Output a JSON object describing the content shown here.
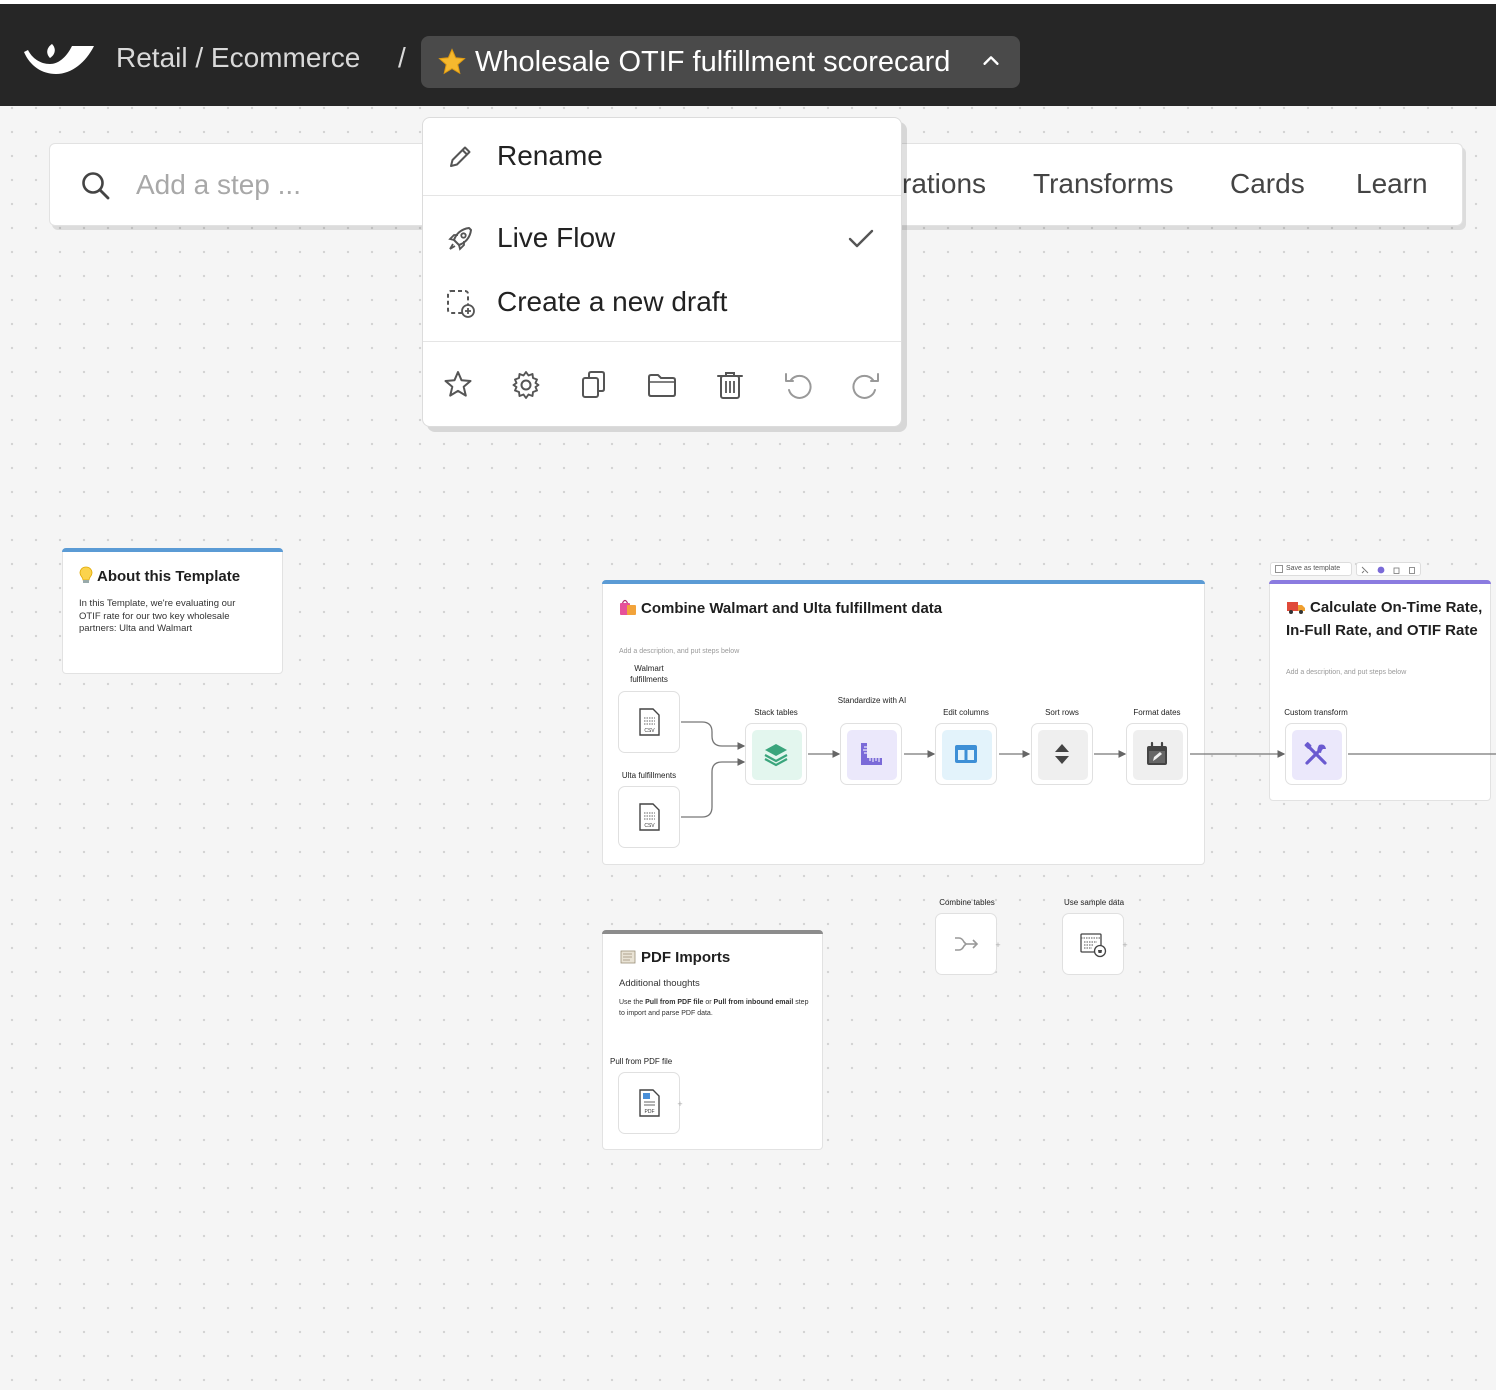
{
  "header": {
    "breadcrumb": "Retail / Ecommerce",
    "separator": "/",
    "flow_title": "Wholesale OTIF fulfillment scorecard"
  },
  "toolbar": {
    "search_placeholder": "Add a step ...",
    "tabs": [
      "rations",
      "Transforms",
      "Cards",
      "Learn"
    ]
  },
  "menu": {
    "rename": "Rename",
    "live_flow": "Live Flow",
    "live_flow_checked": true,
    "new_draft": "Create a new draft",
    "actions": [
      "star-icon",
      "gear-icon",
      "copy-icon",
      "folder-icon",
      "trash-icon",
      "undo-icon",
      "redo-icon"
    ]
  },
  "cards": {
    "about": {
      "title": "About this Template",
      "body": "In this Template, we're evaluating our OTIF rate for our two key wholesale partners: Ulta and Walmart"
    },
    "combine": {
      "title": "Combine Walmart and Ulta fulfillment data",
      "hint": "Add a description, and put steps below"
    },
    "calculate": {
      "title": "Calculate On-Time Rate, In-Full Rate, and OTIF Rate",
      "hint": "Add a description, and put steps below",
      "save_template": "Save as template"
    },
    "pdf": {
      "title": "PDF Imports",
      "subtitle": "Additional thoughts",
      "body_pre": "Use the ",
      "body_b1": "Pull from PDF file",
      "body_mid": " or ",
      "body_b2": "Pull from inbound email",
      "body_post": " step to import and parse PDF data."
    }
  },
  "nodes": {
    "walmart": "Walmart fulfillments",
    "ulta": "Ulta fulfillments",
    "stack": "Stack tables",
    "standardize": "Standardize with AI",
    "edit_columns": "Edit columns",
    "sort_rows": "Sort rows",
    "format_dates": "Format dates",
    "custom_transform": "Custom transform",
    "combine_tables": "Combine tables",
    "sample_data": "Use sample data",
    "pull_pdf": "Pull from PDF file",
    "csv": "CSV",
    "pdf": "PDF",
    "plus": "+"
  },
  "colors": {
    "topbar": "#262626",
    "blue_accent": "#5b9bd5",
    "purple_accent": "#8b7be0",
    "gray_accent": "#8c8c8c",
    "stack_green": "#3aa57c",
    "standardize_purple": "#7a6ad8",
    "edit_blue": "#3d8fd6"
  }
}
